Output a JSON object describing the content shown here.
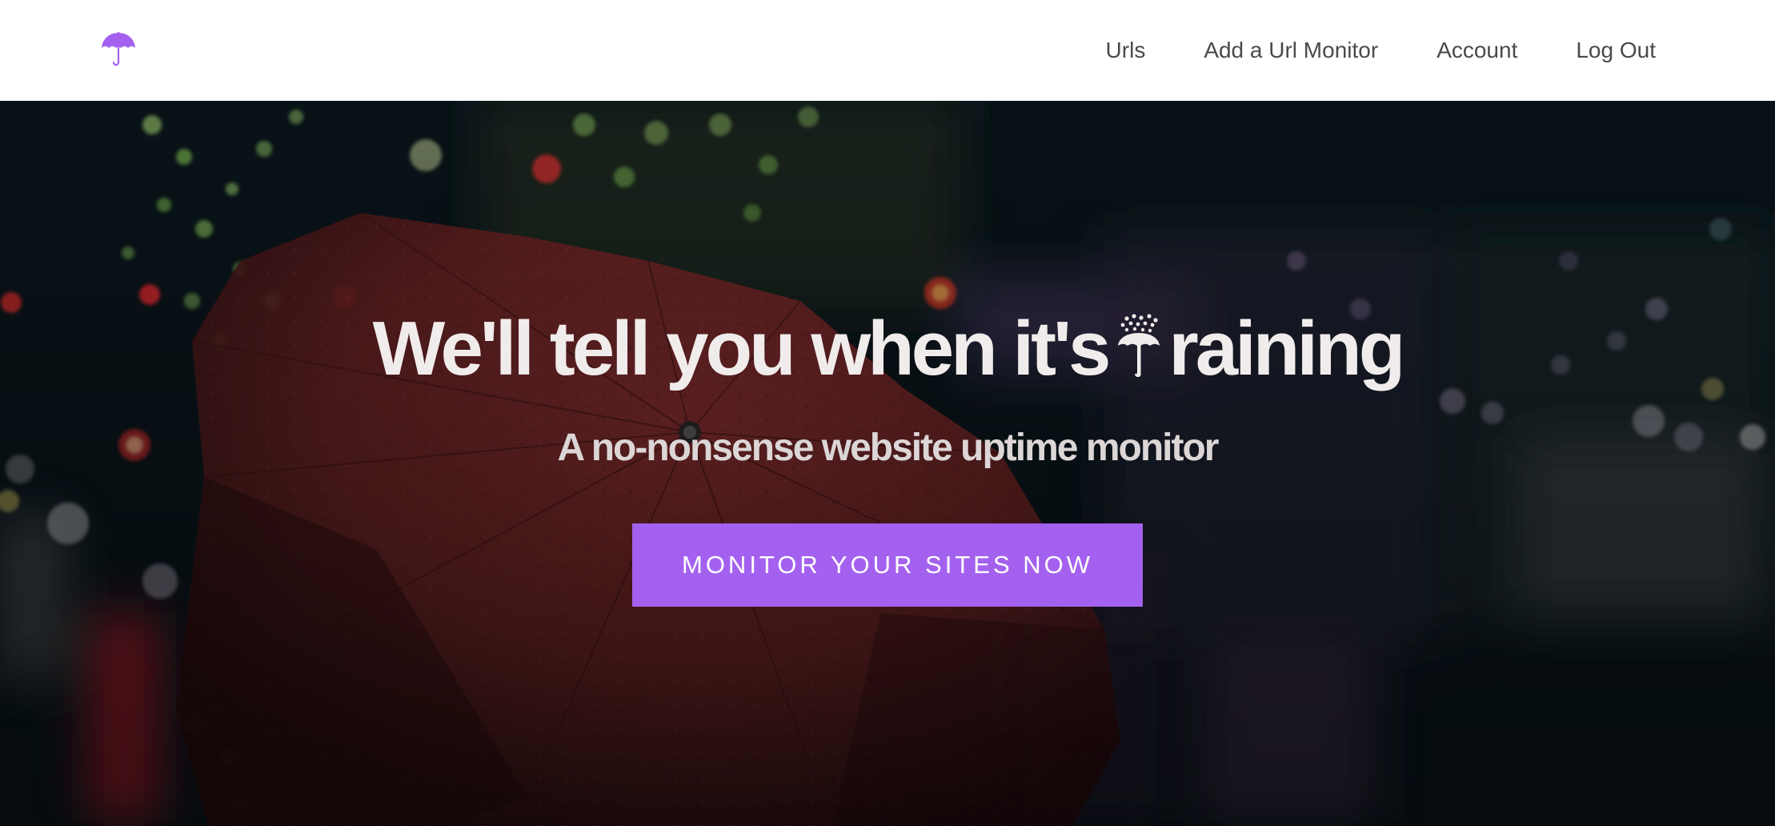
{
  "brand": {
    "logo_icon": "umbrella-icon",
    "accent_color": "#a461ef"
  },
  "nav": {
    "links": [
      {
        "label": "Urls"
      },
      {
        "label": "Add a Url Monitor"
      },
      {
        "label": "Account"
      },
      {
        "label": "Log Out"
      }
    ]
  },
  "hero": {
    "title_before_icon": "We'll tell you when it's",
    "title_icon": "umbrella-with-rain-icon",
    "title_after_icon": "raining",
    "subtitle": "A no-nonsense website uptime monitor",
    "cta_label": "MONITOR YOUR SITES NOW",
    "background": "blurred-night-street-red-umbrella-photo"
  }
}
